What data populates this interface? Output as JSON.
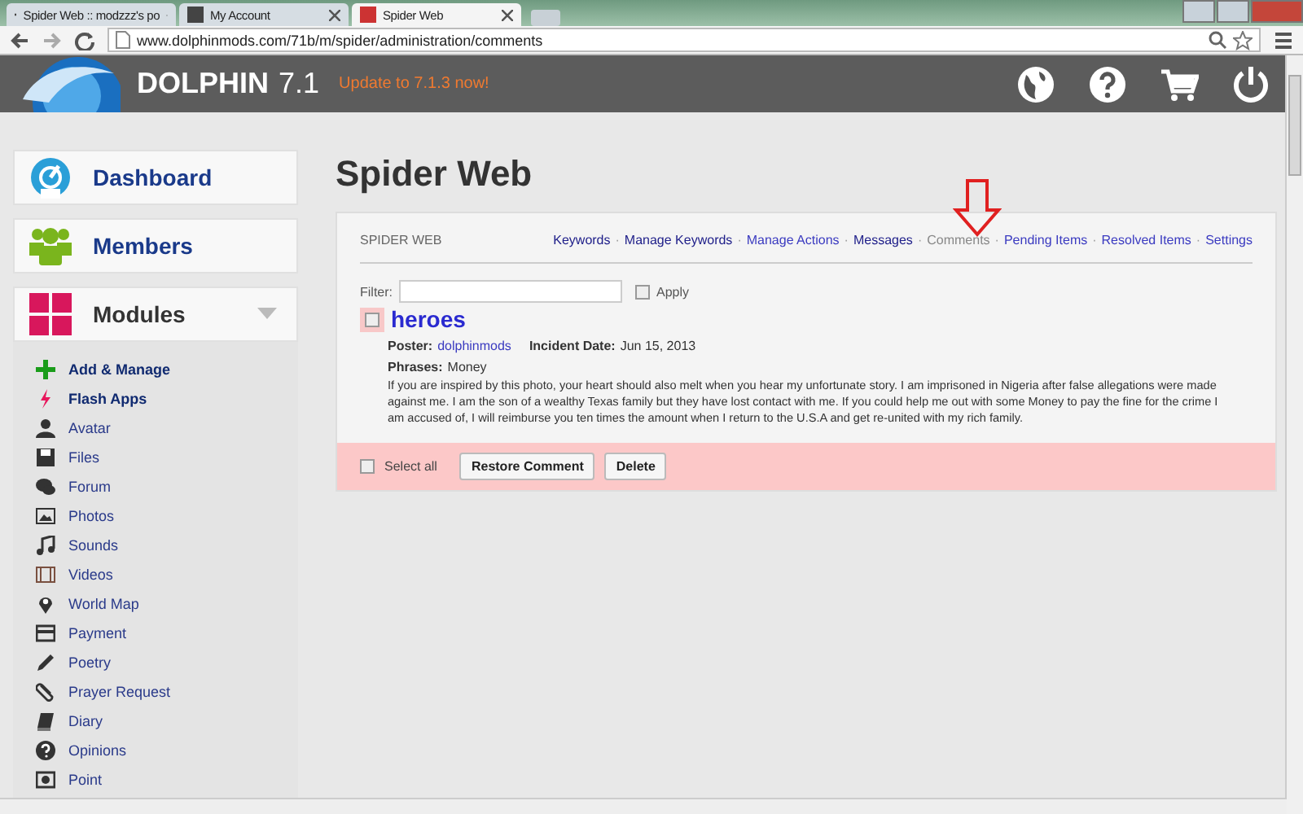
{
  "browser": {
    "tabs": [
      {
        "label": "Spider Web :: modzzz's po",
        "selected": false
      },
      {
        "label": "My Account",
        "selected": false
      },
      {
        "label": "Spider Web",
        "selected": true
      }
    ],
    "url": "www.dolphinmods.com/71b/m/spider/administration/comments"
  },
  "header": {
    "brand": "DOLPHIN",
    "version": "7.1",
    "update": "Update to 7.1.3 now!"
  },
  "sidebar": {
    "sections": [
      {
        "label": "Dashboard",
        "expanded": false
      },
      {
        "label": "Members",
        "expanded": false
      },
      {
        "label": "Modules",
        "expanded": true
      }
    ],
    "items": [
      {
        "label": "Add & Manage",
        "emphasized": true
      },
      {
        "label": "Flash Apps",
        "emphasized": true
      },
      {
        "label": "Avatar",
        "emphasized": false
      },
      {
        "label": "Files",
        "emphasized": false
      },
      {
        "label": "Forum",
        "emphasized": false
      },
      {
        "label": "Photos",
        "emphasized": false
      },
      {
        "label": "Sounds",
        "emphasized": false
      },
      {
        "label": "Videos",
        "emphasized": false
      },
      {
        "label": "World Map",
        "emphasized": false
      },
      {
        "label": "Payment",
        "emphasized": false
      },
      {
        "label": "Poetry",
        "emphasized": false
      },
      {
        "label": "Prayer Request",
        "emphasized": false
      },
      {
        "label": "Diary",
        "emphasized": false
      },
      {
        "label": "Opinions",
        "emphasized": false
      },
      {
        "label": "Point",
        "emphasized": false
      }
    ]
  },
  "page": {
    "title": "Spider Web",
    "panel": {
      "caption": "SPIDER WEB",
      "separator": "·",
      "menu": [
        {
          "label": "Keywords",
          "selected": false,
          "visited": true
        },
        {
          "label": "Manage Keywords",
          "selected": false,
          "visited": true
        },
        {
          "label": "Manage Actions",
          "selected": false,
          "visited": false
        },
        {
          "label": "Messages",
          "selected": false,
          "visited": true
        },
        {
          "label": "Comments",
          "selected": true,
          "visited": false
        },
        {
          "label": "Pending Items",
          "selected": false,
          "visited": false
        },
        {
          "label": "Resolved Items",
          "selected": false,
          "visited": false
        },
        {
          "label": "Settings",
          "selected": false,
          "visited": false
        }
      ],
      "filter": {
        "label": "Filter:",
        "apply": "Apply",
        "apply_checked": false
      },
      "entries": [
        {
          "title": "heroes",
          "checked": false,
          "poster_label": "Poster:",
          "poster": "dolphinmods",
          "date_label": "Incident Date:",
          "date": "Jun 15, 2013",
          "phrases_label": "Phrases:",
          "phrases": "Money",
          "text": "If you are inspired by this photo, your heart should also melt when you hear my unfortunate story. I am imprisoned in Nigeria after false allegations were made against me. I am the son of a wealthy Texas family but they have lost contact with me. If you could help me out with some Money to pay the fine for the crime I am accused of, I will reimburse you ten times the amount when I return to the U.S.A and get re-united with my rich family."
        }
      ],
      "footer": {
        "select_all": "Select all",
        "select_all_checked": false,
        "buttons": [
          "Restore Comment",
          "Delete"
        ]
      }
    }
  }
}
